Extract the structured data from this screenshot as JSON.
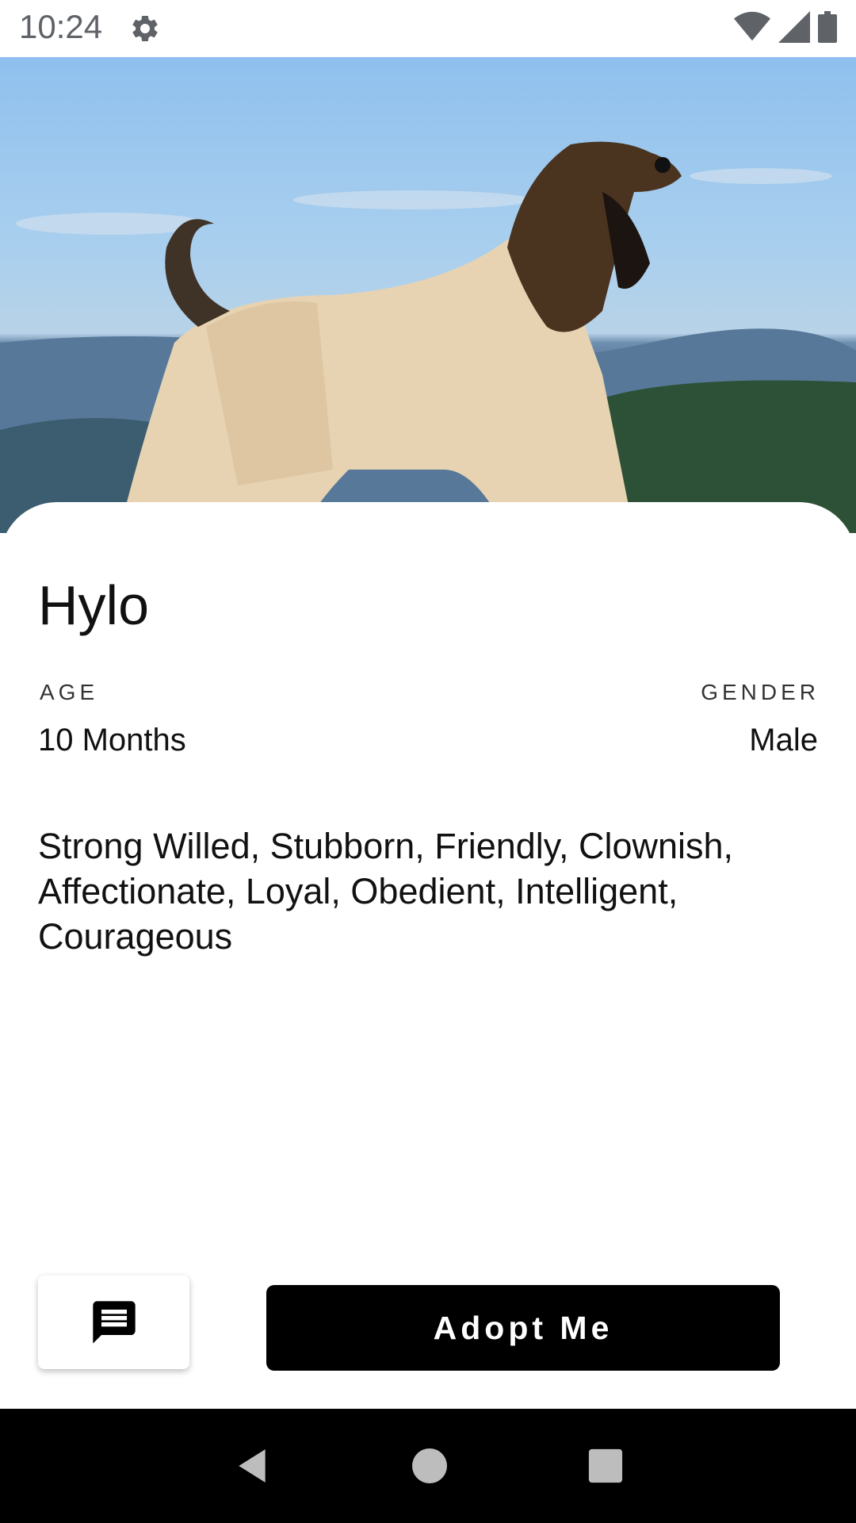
{
  "status_bar": {
    "time": "10:24",
    "icons": [
      "gear-icon",
      "wifi-icon",
      "cell-signal-icon",
      "battery-icon"
    ]
  },
  "pet": {
    "name": "Hylo",
    "age_label": "AGE",
    "age_value": "10 Months",
    "gender_label": "GENDER",
    "gender_value": "Male",
    "traits": "Strong Willed, Stubborn, Friendly, Clownish, Affectionate, Loyal, Obedient, Intelligent, Courageous"
  },
  "actions": {
    "chat_icon": "chat-icon",
    "adopt_label": "Adopt Me"
  },
  "nav": {
    "icons": [
      "back-icon",
      "home-icon",
      "recents-icon"
    ]
  },
  "colors": {
    "accent": "#000000",
    "background": "#ffffff"
  }
}
